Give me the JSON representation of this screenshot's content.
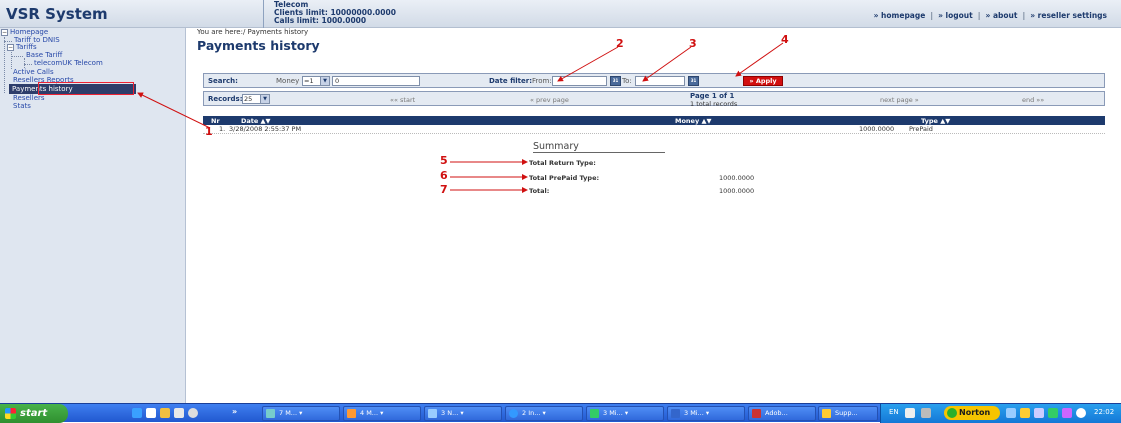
{
  "header": {
    "app_title": "VSR System",
    "info_line1": "Telecom",
    "info_line2": "Clients limit: 10000000.0000",
    "info_line3": "Calls limit: 1000.0000",
    "links": [
      "» homepage",
      "» logout",
      "» about",
      "» reseller settings"
    ]
  },
  "sidebar": {
    "homepage": "Homepage",
    "tariff_to_dnis": "Tariff to DNIS",
    "tariffs": "Tariffs",
    "base_tariff": "Base Tariff",
    "telecom_uk": "telecomUK Telecom",
    "active_calls": "Active Calls",
    "resellers_reports": "Resellers Reports",
    "payments_history": "Payments history",
    "resellers": "Resellers",
    "stats": "Stats"
  },
  "main": {
    "breadcrumb": "You are here:/ Payments history",
    "page_title": "Payments history",
    "search": {
      "label": "Search:",
      "field": "Money",
      "operator": "=1",
      "value": "0",
      "date_filter_label": "Date filter:",
      "from_label": "From:",
      "from_value": "",
      "to_label": "To:",
      "to_value": "",
      "apply_label": "» Apply"
    },
    "records": {
      "label": "Records:",
      "per_page": "25",
      "first": "«« start",
      "prev": "« prev page",
      "page_info": "Page 1 of 1",
      "total_records": "1 total records",
      "next": "next page »",
      "last": "end »»"
    },
    "table": {
      "headers": {
        "nr": "Nr",
        "date": "Date ▲▼",
        "money": "Money ▲▼",
        "type": "Type ▲▼"
      },
      "rows": [
        {
          "nr": "1.",
          "date": "3/28/2008 2:55:37 PM",
          "money": "1000.0000",
          "type": "PrePaid"
        }
      ]
    },
    "summary": {
      "title": "Summary",
      "items": [
        {
          "label": "Total Return Type:",
          "value": ""
        },
        {
          "label": "Total PrePaid Type:",
          "value": "1000.0000"
        },
        {
          "label": "Total:",
          "value": "1000.0000"
        }
      ]
    }
  },
  "annotations": [
    "1",
    "2",
    "3",
    "4",
    "5",
    "6",
    "7"
  ],
  "taskbar": {
    "start_label": "start",
    "quick_launch_overflow": "»",
    "tasks": [
      "7 M...",
      "4 M...",
      "3 N...",
      "2 In...",
      "3 Mi...",
      "3 Mi...",
      "Adob...",
      "Supp..."
    ],
    "language": "EN",
    "norton_label": "Norton",
    "clock": "22:02"
  },
  "colors": {
    "brand_navy": "#1d3a6d",
    "apply_red": "#d20f0f",
    "annotation_red": "#d01010",
    "taskbar_blue": "#2158cf",
    "start_green": "#2f8f2f"
  }
}
